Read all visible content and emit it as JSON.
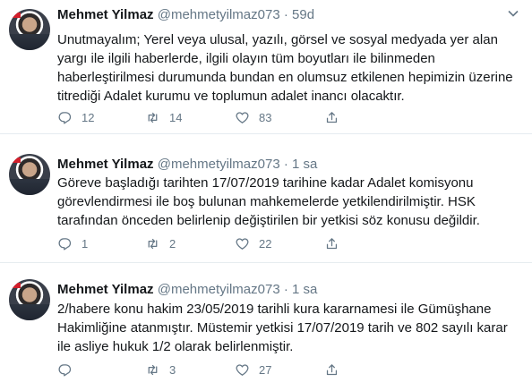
{
  "tweets": [
    {
      "author_name": "Mehmet Yilmaz",
      "author_handle": "@mehmetyilmaz073",
      "dot": "·",
      "time": "59d",
      "text": "Unutmayalım; Yerel veya ulusal, yazılı, görsel ve sosyal medyada yer alan yargı ile ilgili haberlerde, ilgili olayın tüm boyutları ile bilinmeden haberleştirilmesi durumunda bundan en olumsuz etkilenen hepimizin üzerine titrediği Adalet kurumu ve toplumun adalet inancı olacaktır.",
      "replies": "12",
      "retweets": "14",
      "likes": "83"
    },
    {
      "author_name": "Mehmet Yilmaz",
      "author_handle": "@mehmetyilmaz073",
      "dot": "·",
      "time": "1 sa",
      "text": "Göreve başladığı tarihten 17/07/2019  tarihine kadar Adalet komisyonu görevlendirmesi ile boş bulunan mahkemelerde yetkilendirilmiştir. HSK tarafından önceden belirlenip değiştirilen bir yetkisi söz konusu değildir.",
      "replies": "1",
      "retweets": "2",
      "likes": "22"
    },
    {
      "author_name": "Mehmet Yilmaz",
      "author_handle": "@mehmetyilmaz073",
      "dot": "·",
      "time": "1 sa",
      "text": "2/habere konu hakim 23/05/2019 tarihli kura kararnamesi ile Gümüşhane Hakimliğine atanmıştır. Müstemir yetkisi 17/07/2019 tarih ve 802 sayılı karar ile asliye hukuk 1/2 olarak belirlenmiştir.",
      "replies": "",
      "retweets": "3",
      "likes": "27"
    }
  ],
  "icons": {
    "reply": "reply-icon",
    "retweet": "retweet-icon",
    "like": "heart-icon",
    "share": "share-icon",
    "caret": "chevron-down-icon"
  },
  "colors": {
    "text": "#14171a",
    "muted": "#657786",
    "divider": "#e6ecf0"
  }
}
